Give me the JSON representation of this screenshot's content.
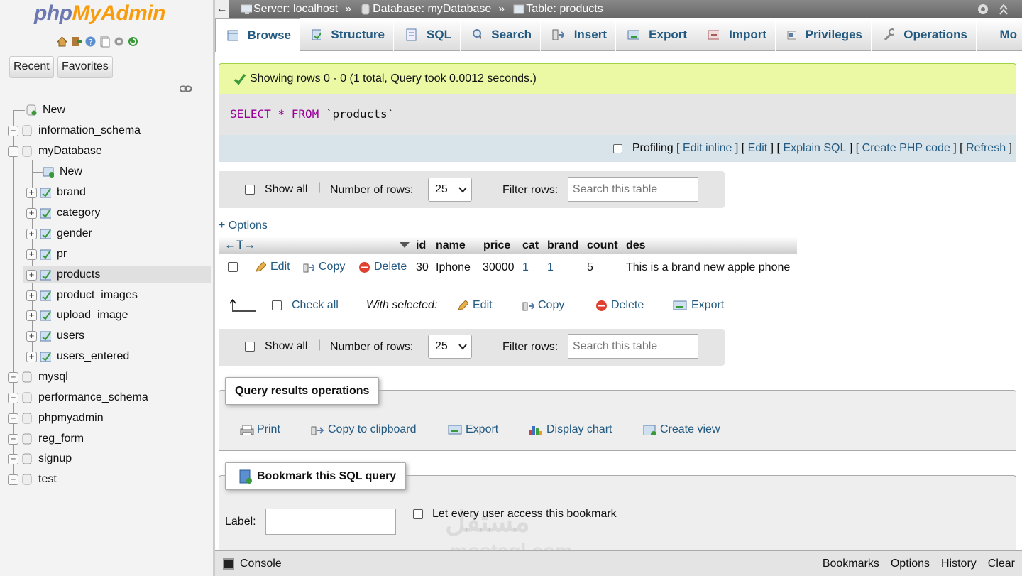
{
  "logo": {
    "part1": "php",
    "part2": "MyAdmin"
  },
  "nav": {
    "recent_label": "Recent",
    "favorites_label": "Favorites",
    "new_label": "New",
    "databases": [
      {
        "name": "information_schema"
      },
      {
        "name": "myDatabase"
      },
      {
        "name": "mysql"
      },
      {
        "name": "performance_schema"
      },
      {
        "name": "phpmyadmin"
      },
      {
        "name": "reg_form"
      },
      {
        "name": "signup"
      },
      {
        "name": "test"
      }
    ],
    "mydb_new_label": "New",
    "tables": [
      "brand",
      "category",
      "gender",
      "pr",
      "products",
      "product_images",
      "upload_image",
      "users",
      "users_entered"
    ],
    "selected_table": "products"
  },
  "breadcrumb": {
    "server": "Server: localhost",
    "database": "Database: myDatabase",
    "table": "Table: products",
    "separator": "»"
  },
  "tabs": [
    "Browse",
    "Structure",
    "SQL",
    "Search",
    "Insert",
    "Export",
    "Import",
    "Privileges",
    "Operations",
    "Mo"
  ],
  "active_tab": "Browse",
  "success_message": "Showing rows 0 - 0 (1 total, Query took 0.0012 seconds.)",
  "sql": {
    "select": "SELECT",
    "star": "*",
    "from": "FROM",
    "table": "`products`"
  },
  "sql_links": {
    "profiling": "Profiling",
    "edit_inline": "Edit inline",
    "edit": "Edit",
    "explain": "Explain SQL",
    "create_php": "Create PHP code",
    "refresh": "Refresh"
  },
  "navbar": {
    "show_all": "Show all",
    "number_of_rows": "Number of rows:",
    "rows_value": "25",
    "filter_rows": "Filter rows:",
    "search_placeholder": "Search this table"
  },
  "options_label": "+ Options",
  "table": {
    "sort_arrows": "←T→",
    "columns": [
      "id",
      "name",
      "price",
      "cat",
      "brand",
      "count",
      "des"
    ],
    "rows": [
      {
        "edit": "Edit",
        "copy": "Copy",
        "delete": "Delete",
        "id": "30",
        "name": "Iphone",
        "price": "30000",
        "cat": "1",
        "brand": "1",
        "count": "5",
        "des": "This is a brand new apple phone"
      }
    ]
  },
  "bulk": {
    "check_all": "Check all",
    "with_selected": "With selected:",
    "edit": "Edit",
    "copy": "Copy",
    "delete": "Delete",
    "export": "Export"
  },
  "query_ops": {
    "legend": "Query results operations",
    "print": "Print",
    "copy_clipboard": "Copy to clipboard",
    "export": "Export",
    "display_chart": "Display chart",
    "create_view": "Create view"
  },
  "bookmark": {
    "legend": "Bookmark this SQL query",
    "label": "Label:",
    "every_user": "Let every user access this bookmark"
  },
  "console": {
    "label": "Console",
    "bookmarks": "Bookmarks",
    "options": "Options",
    "history": "History",
    "clear": "Clear"
  },
  "watermark": {
    "text": "مستقل",
    "latin": "mostaql.com"
  },
  "colors": {
    "link": "#235a81",
    "success_bg": "#ebf8a4",
    "sql_keyword": "#990099",
    "logo_php": "#6c78af",
    "logo_myadmin": "#f89c0e"
  }
}
